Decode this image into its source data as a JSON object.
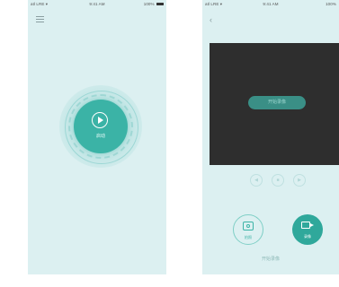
{
  "status_bar": {
    "left": "atl LRE ▾",
    "time": "9:41 AM",
    "battery": "100%"
  },
  "left_screen": {
    "start_label": "启动"
  },
  "right_screen": {
    "back_glyph": "‹",
    "start_record_label": "开始录像",
    "controls": [
      "◀",
      "■",
      "▶"
    ],
    "photo_label": "拍照",
    "record_label": "录像",
    "footer": "开始录像"
  },
  "colors": {
    "background": "#dcf0f1",
    "accent": "#3bb3a6",
    "video": "#2e2e2e"
  },
  "icons": {
    "menu": "menu-icon",
    "play": "play-icon",
    "back": "back-icon",
    "camera": "camera-icon",
    "video": "video-camera-icon"
  }
}
